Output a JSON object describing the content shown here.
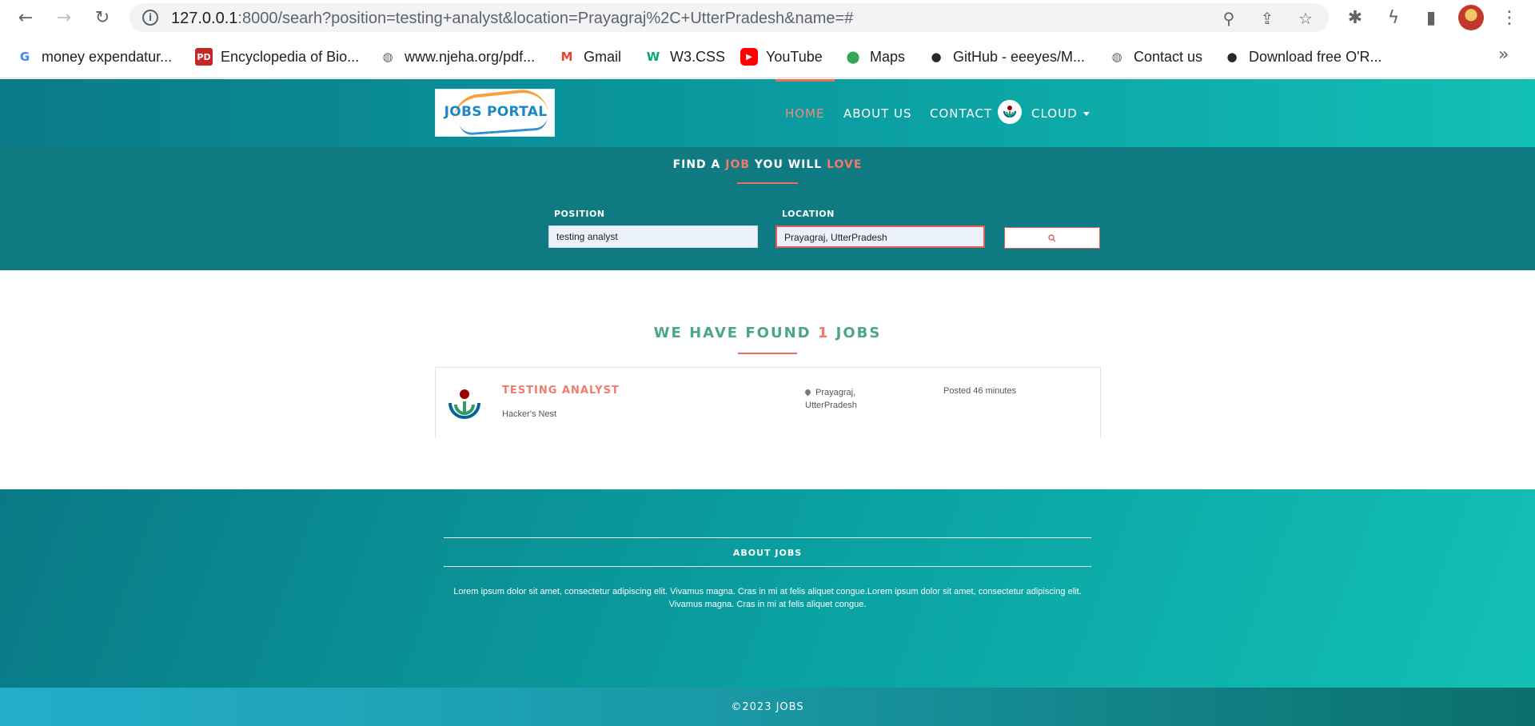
{
  "browser": {
    "url_host": "127.0.0.1",
    "url_rest": ":8000/searh?position=testing+analyst&location=Prayagraj%2C+UtterPradesh&name=#",
    "bookmarks": [
      {
        "label": "money expendatur...",
        "icon": "google-icon",
        "color": "#4285f4"
      },
      {
        "label": "Encyclopedia of Bio...",
        "icon": "pd-icon",
        "color": "#d32f2f"
      },
      {
        "label": "www.njeha.org/pdf...",
        "icon": "globe-icon",
        "color": "#5f6368"
      },
      {
        "label": "Gmail",
        "icon": "gmail-icon",
        "color": "#ea4335"
      },
      {
        "label": "W3.CSS",
        "icon": "w3-icon",
        "color": "#04aa6d"
      },
      {
        "label": "YouTube",
        "icon": "youtube-icon",
        "color": "#ff0000"
      },
      {
        "label": "Maps",
        "icon": "maps-icon",
        "color": "#34a853"
      },
      {
        "label": "GitHub - eeeyes/M...",
        "icon": "github-icon",
        "color": "#24292e"
      },
      {
        "label": "Contact us",
        "icon": "globe-icon",
        "color": "#5f6368"
      },
      {
        "label": "Download free O'R...",
        "icon": "github-icon",
        "color": "#24292e"
      }
    ]
  },
  "header": {
    "logo_text": "JOBS PORTAL",
    "nav": {
      "home": "HOME",
      "about": "ABOUT US",
      "contact": "CONTACT",
      "user": "CLOUD"
    },
    "accent_color": "#f06b5e"
  },
  "search": {
    "title_part1": "FIND A ",
    "title_accent1": "JOB",
    "title_part2": " YOU WILL ",
    "title_accent2": "LOVE",
    "position_label": "POSITION",
    "position_value": "testing analyst",
    "location_label": "LOCATION",
    "location_value": "Prayagraj, UtterPradesh"
  },
  "results": {
    "title_part1": "WE HAVE FOUND ",
    "count": "1",
    "title_part2": " JOBS",
    "jobs": [
      {
        "title": "TESTING ANALYST",
        "company": "Hacker's Nest",
        "location": "Prayagraj, UtterPradesh",
        "posted": "Posted 46 minutes"
      }
    ]
  },
  "footer": {
    "heading": "ABOUT JOBS",
    "text": "Lorem ipsum dolor sit amet, consectetur adipiscing elit. Vivamus magna. Cras in mi at felis aliquet congue.Lorem ipsum dolor sit amet, consectetur adipiscing elit. Vivamus magna. Cras in mi at felis aliquet congue.",
    "copyright": "©2023 JOBS"
  }
}
